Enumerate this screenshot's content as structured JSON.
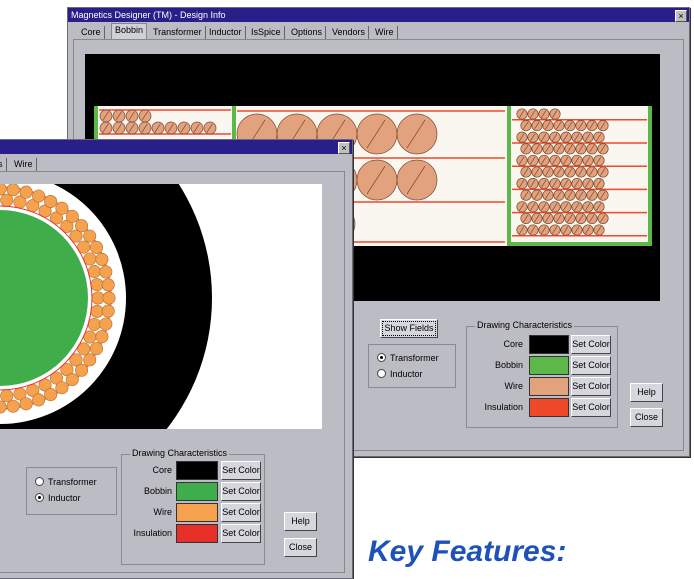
{
  "back_window": {
    "title": "Magnetics Designer (TM) - Design Info",
    "close_glyph": "×",
    "tabs": [
      "Core",
      "Bobbin",
      "Transformer",
      "Inductor",
      "IsSpice",
      "Options",
      "Vendors",
      "Wire"
    ],
    "active_tab": "Bobbin",
    "show_fields": "Show Fields",
    "radios": [
      {
        "label": "Transformer",
        "checked": true
      },
      {
        "label": "Inductor",
        "checked": false
      }
    ],
    "drawing_title": "Drawing Characteristics",
    "rows": [
      {
        "label": "Core",
        "color": "#000000",
        "button": "Set Color"
      },
      {
        "label": "Bobbin",
        "color": "#5db84a",
        "button": "Set Color"
      },
      {
        "label": "Wire",
        "color": "#e2a27e",
        "button": "Set Color"
      },
      {
        "label": "Insulation",
        "color": "#ee4a2a",
        "button": "Set Color"
      }
    ],
    "help": "Help",
    "close": "Close"
  },
  "front_window": {
    "close_glyph": "×",
    "tabs_visible": [
      "s",
      "Wire"
    ],
    "radios": [
      {
        "label": "Transformer",
        "checked": false
      },
      {
        "label": "Inductor",
        "checked": true
      }
    ],
    "drawing_title": "Drawing Characteristics",
    "rows": [
      {
        "label": "Core",
        "color": "#000000",
        "button": "Set Color"
      },
      {
        "label": "Bobbin",
        "color": "#3fae4a",
        "button": "Set Color"
      },
      {
        "label": "Wire",
        "color": "#f6a14e",
        "button": "Set Color"
      },
      {
        "label": "Insulation",
        "color": "#e8302a",
        "button": "Set Color"
      }
    ],
    "help": "Help",
    "close": "Close"
  },
  "footer_text": "Key Features:"
}
